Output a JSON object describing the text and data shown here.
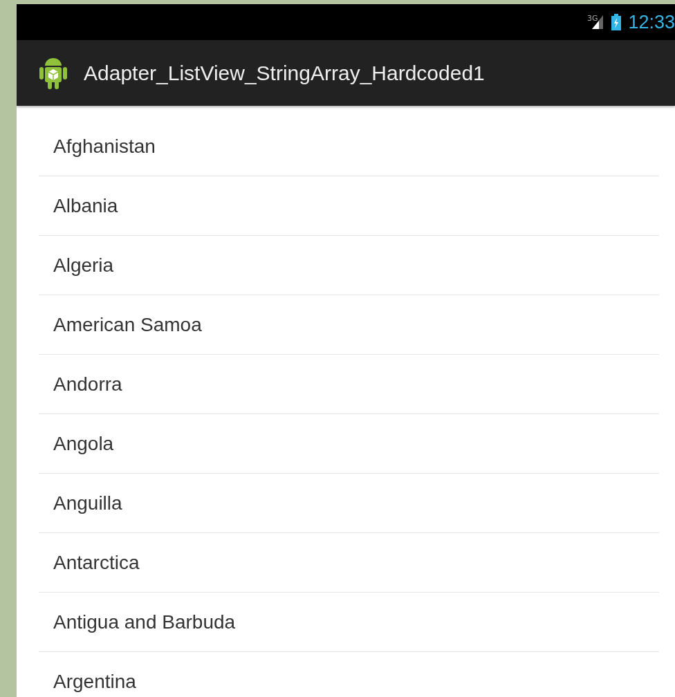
{
  "status_bar": {
    "network": "3G",
    "time": "12:33"
  },
  "action_bar": {
    "title": "Adapter_ListView_StringArray_Hardcoded1"
  },
  "list": {
    "items": [
      "Afghanistan",
      "Albania",
      "Algeria",
      "American Samoa",
      "Andorra",
      "Angola",
      "Anguilla",
      "Antarctica",
      "Antigua and Barbuda",
      "Argentina"
    ]
  }
}
